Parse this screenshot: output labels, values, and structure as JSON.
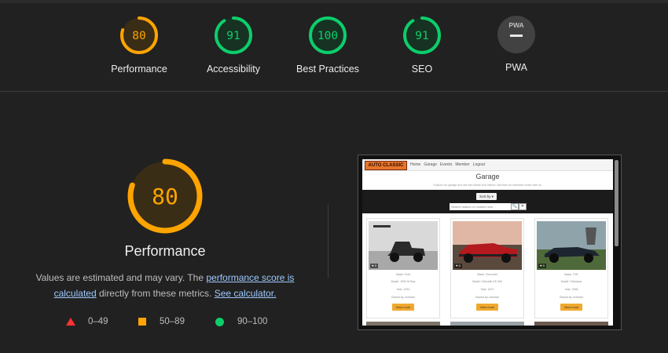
{
  "gauges": [
    {
      "label": "Performance",
      "score": "80",
      "value": 80,
      "color": "#ffa400",
      "bg": "#3a2d16"
    },
    {
      "label": "Accessibility",
      "score": "91",
      "value": 91,
      "color": "#0cce6b",
      "bg": "#173222"
    },
    {
      "label": "Best Practices",
      "score": "100",
      "value": 100,
      "color": "#0cce6b",
      "bg": "#173222"
    },
    {
      "label": "SEO",
      "score": "91",
      "value": 91,
      "color": "#0cce6b",
      "bg": "#173222"
    }
  ],
  "pwa": {
    "label": "PWA",
    "badge_text": "PWA"
  },
  "performance": {
    "score": "80",
    "value": 80,
    "title": "Performance",
    "desc_before": "Values are estimated and may vary. The ",
    "link_score": "performance score is calculated",
    "desc_middle": " directly from these metrics. ",
    "link_calc": "See calculator."
  },
  "legend": [
    {
      "range": "0–49",
      "shape": "triangle",
      "color": "#ff3333"
    },
    {
      "range": "50–89",
      "shape": "square",
      "color": "#ffa400"
    },
    {
      "range": "90–100",
      "shape": "circle",
      "color": "#0cce6b"
    }
  ],
  "screenshot": {
    "logo": "AUTO CLASSIC",
    "nav": [
      "Home",
      "Garage",
      "Events",
      "Member",
      "Logout"
    ],
    "title": "Garage",
    "subtitle": "Explore our garage and see the classic and historic cars that our members share with us.",
    "sort_label": "Sort by ▾",
    "search_placeholder": "Search makes or models here...",
    "search_btn": "🔍",
    "clear_btn": "✕",
    "cards": [
      {
        "make": "Make: Ford",
        "model": "Model: 1932 Hi-Boy",
        "year": "Year: 1932",
        "owner": "Owned by: member",
        "badge": "♥ 0",
        "button": "View more"
      },
      {
        "make": "Make: Chevrolet",
        "model": "Model: Chevelle SS 454",
        "year": "Year: 1970",
        "owner": "Owned by: member",
        "badge": "♥ 0",
        "button": "View more"
      },
      {
        "make": "Make: TVR",
        "model": "Model: Chimaera",
        "year": "Year: 1996",
        "owner": "Owned by: member",
        "badge": "♥ 0",
        "button": "View more"
      }
    ]
  }
}
